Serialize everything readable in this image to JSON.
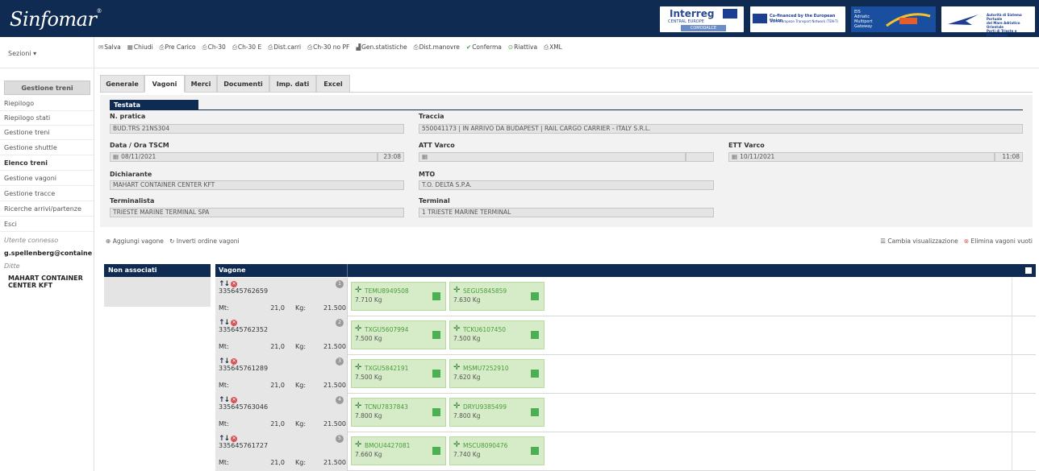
{
  "header": {
    "logo": "Sinfomar",
    "logo_mark": "®",
    "partners": {
      "interreg": "Interreg",
      "interreg_sub": "CENTRAL EUROPE",
      "comodalce": "COMODALCE",
      "cofinanced": "Co-financed by the European Union",
      "cofinanced_sub": "Trans-European Transport Network (TEN-T)",
      "gateway_l1": "EIS",
      "gateway_l2": "Adriatic",
      "gateway_l3": "Multiport",
      "gateway_l4": "Gateway",
      "port_l1": "Autorità di Sistema Portuale",
      "port_l2": "del Mare Adriatico Orientale",
      "port_l3": "Porti di Trieste e Monfalcone"
    }
  },
  "sezioni": "Sezioni ▾",
  "toolbar": [
    {
      "icon": "envelope-icon",
      "glyph": "✉",
      "label": "Salva"
    },
    {
      "icon": "close-icon",
      "glyph": "▦",
      "label": "Chiudi"
    },
    {
      "icon": "print-icon",
      "glyph": "⎙",
      "label": "Pre Carico"
    },
    {
      "icon": "print-icon",
      "glyph": "⎙",
      "label": "Ch-30"
    },
    {
      "icon": "print-icon",
      "glyph": "⎙",
      "label": "Ch-30 E"
    },
    {
      "icon": "print-icon",
      "glyph": "⎙",
      "label": "Dist.carri"
    },
    {
      "icon": "print-icon",
      "glyph": "⎙",
      "label": "Ch-30 no PF"
    },
    {
      "icon": "chart-icon",
      "glyph": "▟",
      "label": "Gen.statistiche"
    },
    {
      "icon": "print-icon",
      "glyph": "⎙",
      "label": "Dist.manovre"
    },
    {
      "icon": "check-icon",
      "glyph": "✔",
      "label": "Conferma"
    },
    {
      "icon": "reactivate-icon",
      "glyph": "⊙",
      "label": "Riattiva"
    },
    {
      "icon": "print-icon",
      "glyph": "⎙",
      "label": "XML"
    }
  ],
  "sidebar": {
    "header": "Gestione treni",
    "items": [
      "Riepilogo",
      "Riepilogo stati",
      "Gestione treni",
      "Gestione shuttle",
      "Elenco treni",
      "Gestione vagoni",
      "Gestione tracce",
      "Ricerche arrivi/partenze",
      "Esci"
    ],
    "user_label": "Utente connesso",
    "user": "g.spellenberg@containe",
    "ditta_label": "Ditte",
    "ditta": "MAHART CONTAINER CENTER KFT"
  },
  "tabs": [
    "Generale",
    "Vagoni",
    "Merci",
    "Documenti",
    "Imp. dati",
    "Excel"
  ],
  "testata": {
    "title": "Testata",
    "n_pratica_label": "N. pratica",
    "n_pratica": "BUD.TRS 21NS304",
    "traccia_label": "Traccia",
    "traccia": "550041173 | IN ARRIVO DA BUDAPEST | RAIL CARGO CARRIER - ITALY S.R.L.",
    "data_label": "Data / Ora TSCM",
    "data": "08/11/2021",
    "ora": "23:08",
    "att_label": "ATT Varco",
    "att": "",
    "ett_label": "ETT Varco",
    "ett": "10/11/2021",
    "ett_ora": "11:08",
    "dichiarante_label": "Dichiarante",
    "dichiarante": "MAHART CONTAINER CENTER KFT",
    "mto_label": "MTO",
    "mto": "T.O. DELTA S.P.A.",
    "terminalista_label": "Terminalista",
    "terminalista": "TRIESTE MARINE TERMINAL SPA",
    "terminal_label": "Terminal",
    "terminal": "1 TRIESTE MARINE TERMINAL"
  },
  "actions": {
    "aggiungi": "Aggiungi vagone",
    "inverti": "Inverti ordine vagoni",
    "cambia": "Cambia visualizzazione",
    "elimina": "Elimina vagoni vuoti"
  },
  "grid": {
    "non_associati": "Non associati",
    "vagone": "Vagone",
    "mt_label": "Mt:",
    "kg_label": "Kg:",
    "rows": [
      {
        "num": "335645762659",
        "badge": "1",
        "mt": "21,0",
        "kg": "21.500",
        "containers": [
          {
            "code": "TEMU8949508",
            "kg": "7.710 Kg"
          },
          {
            "code": "SEGU5845859",
            "kg": "7.630 Kg"
          }
        ]
      },
      {
        "num": "335645762352",
        "badge": "2",
        "mt": "21,0",
        "kg": "21.500",
        "containers": [
          {
            "code": "TXGU5607994",
            "kg": "7.500 Kg"
          },
          {
            "code": "TCKU6107450",
            "kg": "7.500 Kg"
          }
        ]
      },
      {
        "num": "335645761289",
        "badge": "3",
        "mt": "21,0",
        "kg": "21.500",
        "containers": [
          {
            "code": "TXGU5842191",
            "kg": "7.500 Kg"
          },
          {
            "code": "MSMU7252910",
            "kg": "7.620 Kg"
          }
        ]
      },
      {
        "num": "335645763046",
        "badge": "4",
        "mt": "21,0",
        "kg": "21.500",
        "containers": [
          {
            "code": "TCNU7837843",
            "kg": "7.800 Kg"
          },
          {
            "code": "DRYU9385499",
            "kg": "7.800 Kg"
          }
        ]
      },
      {
        "num": "335645761727",
        "badge": "5",
        "mt": "21,0",
        "kg": "21.500",
        "containers": [
          {
            "code": "BMOU4427081",
            "kg": "7.660 Kg"
          },
          {
            "code": "MSCU8090476",
            "kg": "7.740 Kg"
          }
        ]
      }
    ]
  }
}
